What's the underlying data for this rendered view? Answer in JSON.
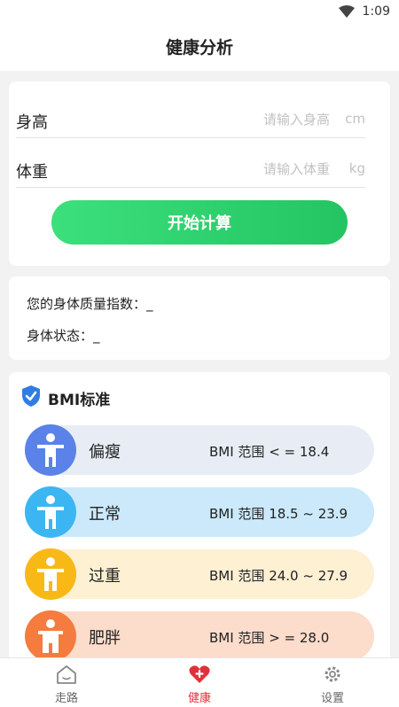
{
  "status_bar": {
    "time": "1:09"
  },
  "header": {
    "title": "健康分析"
  },
  "form": {
    "height": {
      "label": "身高",
      "placeholder": "请输入身高",
      "unit": "cm"
    },
    "weight": {
      "label": "体重",
      "placeholder": "请输入体重",
      "unit": "kg"
    },
    "calculate_label": "开始计算"
  },
  "result": {
    "bmi_line": "您的身体质量指数：_",
    "status_line": "身体状态：_"
  },
  "bmi_standard": {
    "title": "BMI标准",
    "rows": [
      {
        "name": "偏瘦",
        "range": "BMI 范围 < = 18.4",
        "color": "#5b82e8"
      },
      {
        "name": "正常",
        "range": "BMI 范围 18.5 ~ 23.9",
        "color": "#3cb6f2"
      },
      {
        "name": "过重",
        "range": "BMI 范围 24.0 ~ 27.9",
        "color": "#f8b917"
      },
      {
        "name": "肥胖",
        "range": "BMI 范围 > = 28.0",
        "color": "#f57b3f"
      }
    ]
  },
  "tabs": [
    {
      "label": "走路",
      "icon": "home-icon",
      "active": false
    },
    {
      "label": "健康",
      "icon": "health-heart-icon",
      "active": true
    },
    {
      "label": "设置",
      "icon": "gear-icon",
      "active": false
    }
  ],
  "colors": {
    "accent_green": "#24c462",
    "active_tab": "#e0313b",
    "shield_blue": "#2f7de1"
  }
}
